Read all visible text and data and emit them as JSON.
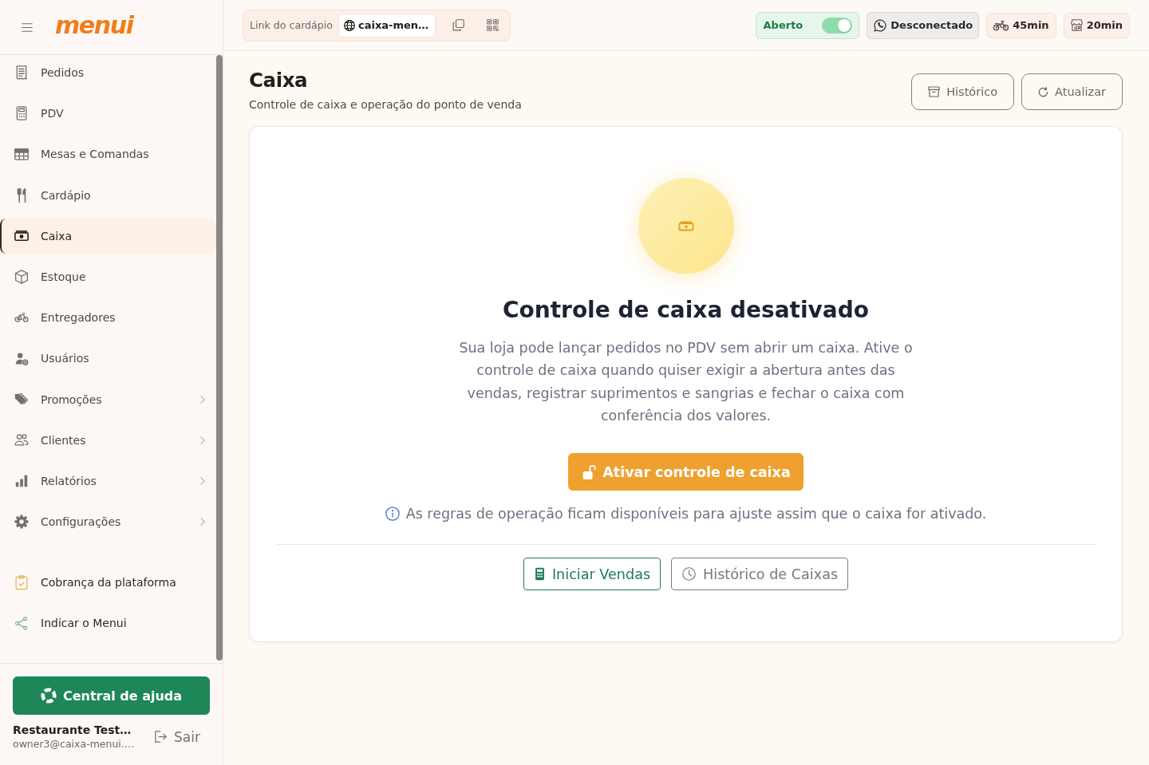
{
  "sidebar": {
    "logo": "menui",
    "nav_items": [
      {
        "label": "Pedidos",
        "selected": false,
        "has_submenu": false
      },
      {
        "label": "PDV",
        "selected": false,
        "has_submenu": false
      },
      {
        "label": "Mesas e Comandas",
        "selected": false,
        "has_submenu": false
      },
      {
        "label": "Cardápio",
        "selected": false,
        "has_submenu": false
      },
      {
        "label": "Caixa",
        "selected": true,
        "has_submenu": false
      },
      {
        "label": "Estoque",
        "selected": false,
        "has_submenu": false
      },
      {
        "label": "Entregadores",
        "selected": false,
        "has_submenu": false
      },
      {
        "label": "Usuários",
        "selected": false,
        "has_submenu": false
      },
      {
        "label": "Promoções",
        "selected": false,
        "has_submenu": true
      },
      {
        "label": "Clientes",
        "selected": false,
        "has_submenu": true
      },
      {
        "label": "Relatórios",
        "selected": false,
        "has_submenu": true
      },
      {
        "label": "Configurações",
        "selected": false,
        "has_submenu": true
      }
    ],
    "extra_links": [
      "Cobrança da plataforma",
      "Indicar o Menui"
    ],
    "help_button": "Central de ajuda",
    "account": {
      "name": "Restaurante Test…",
      "email": "owner3@caixa-menui.…",
      "logout": "Sair"
    }
  },
  "topbar": {
    "menu_link": {
      "label": "Link do cardápio",
      "url": "caixa-men…"
    },
    "store_status": {
      "label": "Aberto",
      "on": true
    },
    "whatsapp_status": {
      "label": "Desconectado",
      "connected": false
    },
    "wait_times": [
      {
        "kind": "delivery",
        "label": "45min"
      },
      {
        "kind": "pickup",
        "label": "20min"
      }
    ]
  },
  "page": {
    "title": "Caixa",
    "subtitle": "Controle de caixa e operação do ponto de venda",
    "actions": [
      {
        "kind": "history",
        "label": "Histórico"
      },
      {
        "kind": "refresh",
        "label": "Atualizar"
      }
    ]
  },
  "empty_state": {
    "heading": "Controle de caixa desativado",
    "description": "Sua loja pode lançar pedidos no PDV sem abrir um caixa. Ative o controle de caixa quando quiser exigir a abertura antes das vendas, registrar suprimentos e sangrias e fechar o caixa com conferência dos valores.",
    "primary_button": "Ativar controle de caixa",
    "note": "As regras de operação ficam disponíveis para ajuste assim que o caixa for ativado.",
    "secondary_actions": [
      {
        "kind": "sales",
        "label": "Iniciar Vendas"
      },
      {
        "kind": "history",
        "label": "Histórico de Caixas"
      }
    ]
  }
}
